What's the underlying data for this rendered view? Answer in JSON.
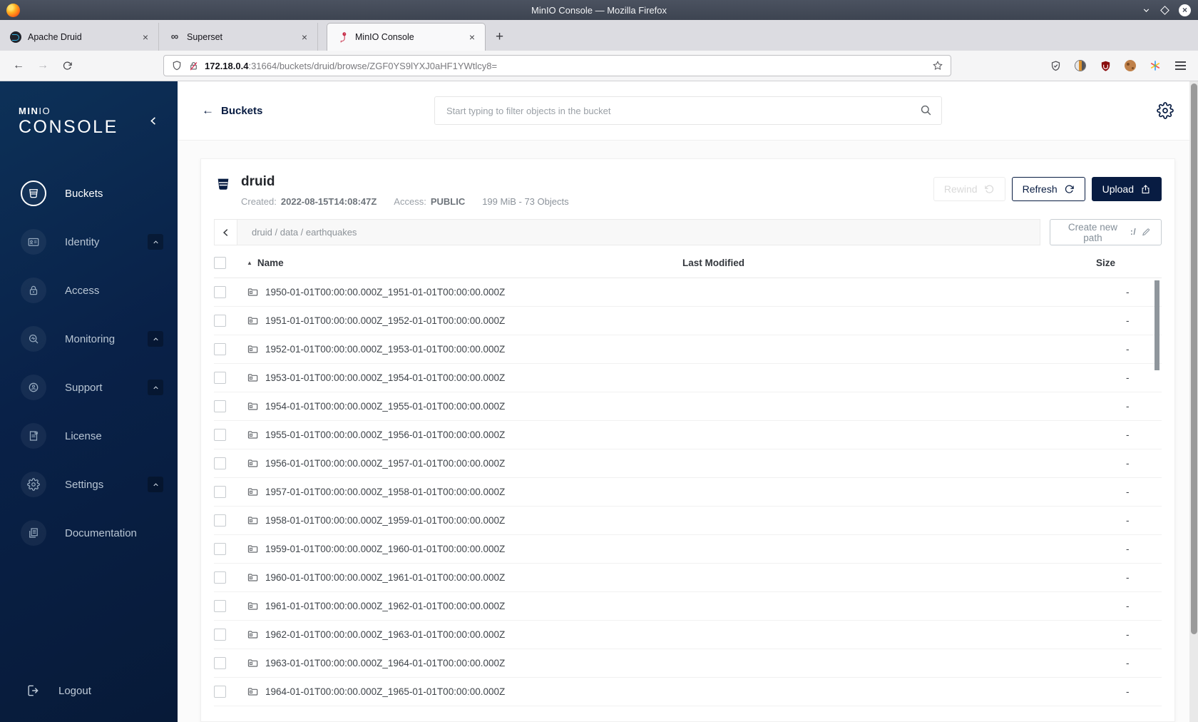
{
  "browser": {
    "title": "MinIO Console — Mozilla Firefox",
    "tabs": [
      {
        "label": "Apache Druid",
        "close": "×"
      },
      {
        "label": "Superset",
        "close": "×"
      },
      {
        "label": "MinIO Console",
        "close": "×"
      }
    ],
    "new_tab": "+",
    "nav": {
      "back": "←",
      "forward": "→"
    },
    "url": {
      "host": "172.18.0.4",
      "path": ":31664/buckets/druid/browse/ZGF0YS9lYXJ0aHF1YWtlcy8="
    },
    "superset_glyph": "∞"
  },
  "sidebar": {
    "logo_strong": "MIN",
    "logo_thin": "IO",
    "logo_console": "CONSOLE",
    "items": [
      {
        "label": "Buckets"
      },
      {
        "label": "Identity"
      },
      {
        "label": "Access"
      },
      {
        "label": "Monitoring"
      },
      {
        "label": "Support"
      },
      {
        "label": "License"
      },
      {
        "label": "Settings"
      },
      {
        "label": "Documentation"
      }
    ],
    "logout_label": "Logout"
  },
  "header": {
    "back_label": "Buckets",
    "back_arrow": "←",
    "search_placeholder": "Start typing to filter objects in the bucket"
  },
  "bucket": {
    "name": "druid",
    "created_label": "Created:",
    "created_value": "2022-08-15T14:08:47Z",
    "access_label": "Access:",
    "access_value": "PUBLIC",
    "usage": "199 MiB - 73 Objects"
  },
  "actions": {
    "rewind": "Rewind",
    "refresh": "Refresh",
    "upload": "Upload",
    "create_path": "Create new path",
    "create_path_glyph": ":/"
  },
  "breadcrumb": {
    "path": "druid / data / earthquakes"
  },
  "table": {
    "headers": {
      "name": "Name",
      "last_modified": "Last Modified",
      "size": "Size",
      "sort_glyph": "▲"
    },
    "rows": [
      {
        "name": "1950-01-01T00:00:00.000Z_1951-01-01T00:00:00.000Z",
        "size": "-"
      },
      {
        "name": "1951-01-01T00:00:00.000Z_1952-01-01T00:00:00.000Z",
        "size": "-"
      },
      {
        "name": "1952-01-01T00:00:00.000Z_1953-01-01T00:00:00.000Z",
        "size": "-"
      },
      {
        "name": "1953-01-01T00:00:00.000Z_1954-01-01T00:00:00.000Z",
        "size": "-"
      },
      {
        "name": "1954-01-01T00:00:00.000Z_1955-01-01T00:00:00.000Z",
        "size": "-"
      },
      {
        "name": "1955-01-01T00:00:00.000Z_1956-01-01T00:00:00.000Z",
        "size": "-"
      },
      {
        "name": "1956-01-01T00:00:00.000Z_1957-01-01T00:00:00.000Z",
        "size": "-"
      },
      {
        "name": "1957-01-01T00:00:00.000Z_1958-01-01T00:00:00.000Z",
        "size": "-"
      },
      {
        "name": "1958-01-01T00:00:00.000Z_1959-01-01T00:00:00.000Z",
        "size": "-"
      },
      {
        "name": "1959-01-01T00:00:00.000Z_1960-01-01T00:00:00.000Z",
        "size": "-"
      },
      {
        "name": "1960-01-01T00:00:00.000Z_1961-01-01T00:00:00.000Z",
        "size": "-"
      },
      {
        "name": "1961-01-01T00:00:00.000Z_1962-01-01T00:00:00.000Z",
        "size": "-"
      },
      {
        "name": "1962-01-01T00:00:00.000Z_1963-01-01T00:00:00.000Z",
        "size": "-"
      },
      {
        "name": "1963-01-01T00:00:00.000Z_1964-01-01T00:00:00.000Z",
        "size": "-"
      },
      {
        "name": "1964-01-01T00:00:00.000Z_1965-01-01T00:00:00.000Z",
        "size": "-"
      }
    ]
  }
}
